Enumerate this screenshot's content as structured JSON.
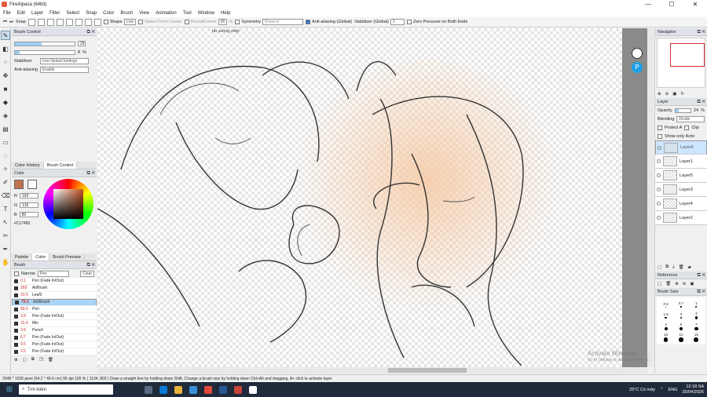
{
  "window": {
    "title": "FireAlpaca (64bit)",
    "min": "—",
    "max": "☐",
    "close": "✕"
  },
  "menu": [
    "File",
    "Edit",
    "Layer",
    "Filter",
    "Select",
    "Snap",
    "Color",
    "Brush",
    "View",
    "Animation",
    "Tool",
    "Window",
    "Help"
  ],
  "toolbar": {
    "snap_label": "Snap",
    "shape_label": "Shape",
    "shape_value": "Line",
    "select_from_center": "Select From Center",
    "round_corner": "RoundCorner",
    "round_value": "80",
    "percent": "%",
    "symmetry_label": "Symmetry",
    "symmetry_value": "Bilateral",
    "antialias_label": "Anti-aliasing (Global)",
    "stabilizer_label": "Stabilizer (Global)",
    "stabilizer_value": "2",
    "zero_pressure": "Zero Pressure on Both Ends"
  },
  "document_tab": "tải xuống.mdp",
  "brush_control": {
    "title": "Brush Control",
    "size_value": "26",
    "size_fraction": 0.45,
    "opacity_value": "8",
    "opacity_unit": "%",
    "opacity_fraction": 0.08,
    "stabilizer_label": "Stabilizer",
    "stabilizer_value": "Use Global Settings",
    "antialias_label": "Anti-aliasing",
    "antialias_value": "Enable"
  },
  "mid_tabs": {
    "color_history": "Color History",
    "brush_control": "Brush Control"
  },
  "color": {
    "title": "Color",
    "primary": "#C17450",
    "r_label": "R",
    "r": "193",
    "g_label": "G",
    "g": "116",
    "b_label": "B",
    "b": "80",
    "hex": "#C17450"
  },
  "lower_tabs": {
    "palette": "Palette",
    "color": "Color",
    "brush_preview": "Brush Preview"
  },
  "brush_panel": {
    "title": "Brush",
    "narrow_label": "Narrow",
    "narrow_value": "Pen",
    "clear_label": "Clear",
    "items": [
      {
        "size": "0.1",
        "name": "Pen (Fade In/Out)"
      },
      {
        "size": "269",
        "name": "AirBrush"
      },
      {
        "size": "10.5",
        "name": "Leaf2"
      },
      {
        "size": "79.5",
        "name": "AirBrush"
      },
      {
        "size": "89.0",
        "name": "Pen"
      },
      {
        "size": "3.8",
        "name": "Pen (Fade In/Out)"
      },
      {
        "size": "15.9",
        "name": "Mix"
      },
      {
        "size": "3.6",
        "name": "Pencil"
      },
      {
        "size": "6.7",
        "name": "Pen (Fade In/Out)"
      },
      {
        "size": "9.5",
        "name": "Pen (Fade In/Out)"
      },
      {
        "size": "3.5",
        "name": "Pen (Fade In/Out)"
      }
    ]
  },
  "navigator": {
    "title": "Navigator"
  },
  "layer_panel": {
    "title": "Layer",
    "opacity_label": "Opacity",
    "opacity_value": "24",
    "opacity_unit": "%",
    "opacity_fraction": 0.24,
    "blending_label": "Blending",
    "blending_value": "Divide",
    "protect_alpha": "Protect A",
    "clip": "Clip",
    "show_only_active": "Show only Activ",
    "layers": [
      "Layer6",
      "Layer1",
      "Layer5",
      "Layer3",
      "Layer4",
      "Layer2"
    ]
  },
  "reference": {
    "title": "Reference"
  },
  "brush_size": {
    "title": "Brush Size",
    "sizes": [
      "0.5",
      "0.7",
      "1",
      "1.5",
      "2",
      "3",
      "4",
      "5",
      "7",
      "10",
      "12",
      "15"
    ]
  },
  "status": "2048 * 1536 pixel  (54.2 * 40.6 cm)  96 dpi  100 %  ( 1134, 800 )  Draw a straight line by holding down Shift, Change a brush size by holding down Ctrl+Alt and dragging, A+ click to activate layer",
  "watermark": {
    "line1": "Activate Windows",
    "line2": "Go to Settings to activate Windows."
  },
  "taskbar": {
    "search": "Tìm kiếm",
    "weather": "25°C  Có mây",
    "lang": "ENG",
    "time": "12:18 SA",
    "date": "25/04/2026"
  }
}
